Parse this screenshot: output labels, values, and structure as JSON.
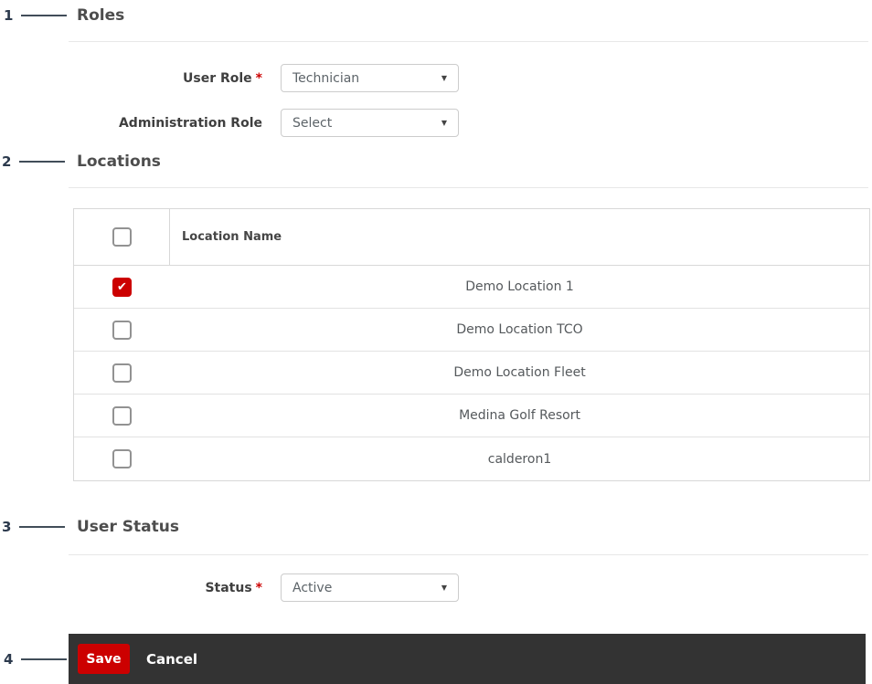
{
  "ui": {
    "required_marker": "*"
  },
  "icons": {
    "dropdown_caret": "▼",
    "checkmark": "✔"
  },
  "callouts": [
    "1",
    "2",
    "3",
    "4"
  ],
  "sections": {
    "roles": {
      "title": "Roles",
      "fields": [
        {
          "label": "User Role",
          "required": true,
          "value": "Technician"
        },
        {
          "label": "Administration Role",
          "required": false,
          "value": "Select"
        }
      ]
    },
    "locations": {
      "title": "Locations",
      "table": {
        "header": "Location Name",
        "rows": [
          {
            "name": "Demo Location 1",
            "checked": true
          },
          {
            "name": "Demo Location TCO",
            "checked": false
          },
          {
            "name": "Demo Location Fleet",
            "checked": false
          },
          {
            "name": "Medina Golf Resort",
            "checked": false
          },
          {
            "name": "calderon1",
            "checked": false
          }
        ]
      }
    },
    "user_status": {
      "title": "User Status",
      "fields": [
        {
          "label": "Status",
          "required": true,
          "value": "Active"
        }
      ]
    }
  },
  "footer": {
    "save_label": "Save",
    "cancel_label": "Cancel"
  },
  "colors": {
    "accent_red": "#cc0000",
    "footer_bar_bg": "#333333",
    "checkbox_checked": "#cc0000"
  }
}
